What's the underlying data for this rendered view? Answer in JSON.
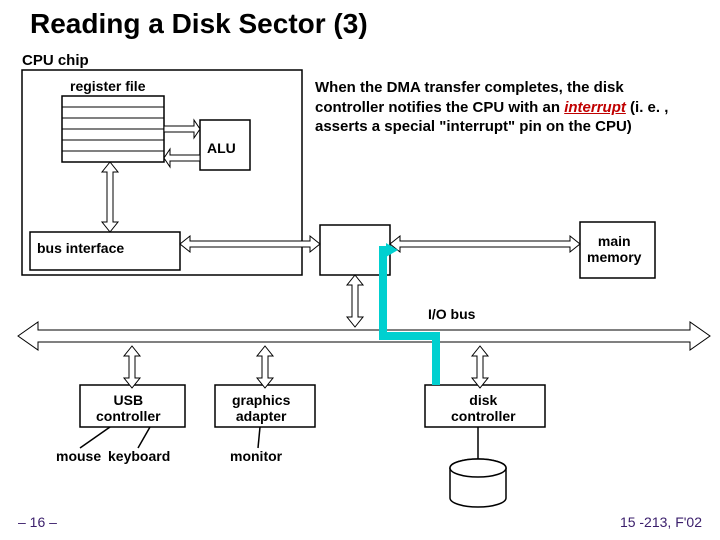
{
  "title": "Reading a Disk Sector (3)",
  "cpu_chip_label": "CPU chip",
  "register_file_label": "register file",
  "alu_label": "ALU",
  "bus_interface_label": "bus interface",
  "main_memory_label": "main\nmemory",
  "io_bus_label": "I/O bus",
  "usb_label": "USB\ncontroller",
  "graphics_label": "graphics\nadapter",
  "disk_ctrl_label": "disk\ncontroller",
  "mouse_label": "mouse",
  "keyboard_label": "keyboard",
  "monitor_label": "monitor",
  "disk_label": "disk",
  "description": {
    "p1": "When the DMA transfer completes, the disk controller notifies the CPU with an ",
    "interrupt": "interrupt",
    "p2": " (i. e. , asserts a special \"interrupt\" pin on the CPU)"
  },
  "footer_left": "– 16 –",
  "footer_right": "15 -213, F'02"
}
